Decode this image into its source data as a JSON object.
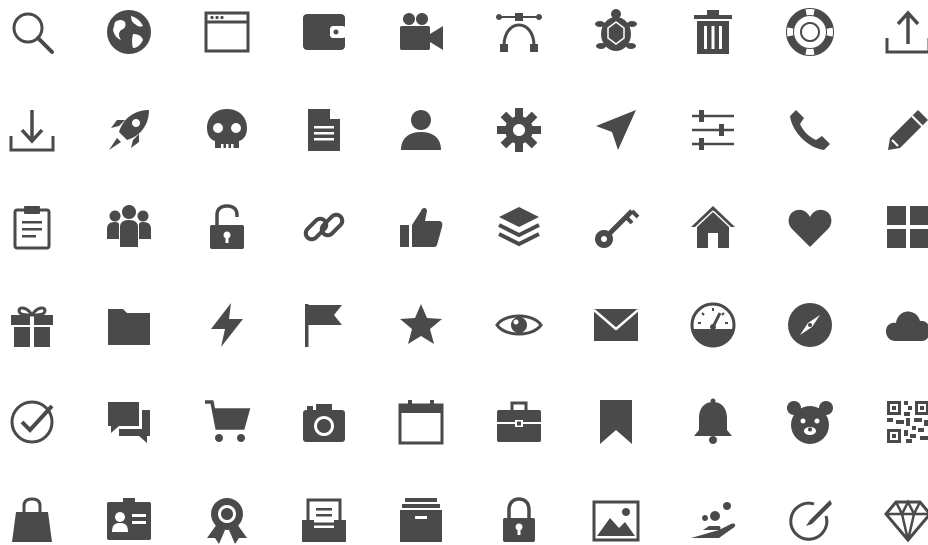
{
  "fill_color": "#4a4a4a",
  "icons": [
    [
      "search-icon",
      "globe-icon",
      "browser-window-icon",
      "wallet-icon",
      "video-camera-icon",
      "bezier-curve-icon",
      "turtle-icon",
      "trash-can-icon",
      "life-ring-icon",
      "upload-icon"
    ],
    [
      "download-icon",
      "rocket-icon",
      "skull-icon",
      "document-icon",
      "user-icon",
      "gear-icon",
      "send-icon",
      "sliders-icon",
      "phone-icon",
      "pencil-icon"
    ],
    [
      "clipboard-icon",
      "group-icon",
      "unlock-icon",
      "link-icon",
      "thumbs-up-icon",
      "layers-icon",
      "key-icon",
      "home-icon",
      "heart-icon",
      "grid-icon"
    ],
    [
      "gift-icon",
      "folder-icon",
      "lightning-icon",
      "flag-icon",
      "star-icon",
      "eye-icon",
      "envelope-icon",
      "speedometer-icon",
      "compass-icon",
      "cloud-icon"
    ],
    [
      "check-circle-icon",
      "chat-bubbles-icon",
      "shopping-cart-icon",
      "camera-icon",
      "calendar-icon",
      "briefcase-icon",
      "bookmark-icon",
      "bell-icon",
      "bear-icon",
      "qr-code-icon"
    ],
    [
      "shopping-bag-icon",
      "id-card-icon",
      "award-ribbon-icon",
      "inbox-tray-icon",
      "archive-box-icon",
      "padlock-icon",
      "image-icon",
      "hand-giving-icon",
      "edit-circle-icon",
      "diamond-icon"
    ]
  ]
}
